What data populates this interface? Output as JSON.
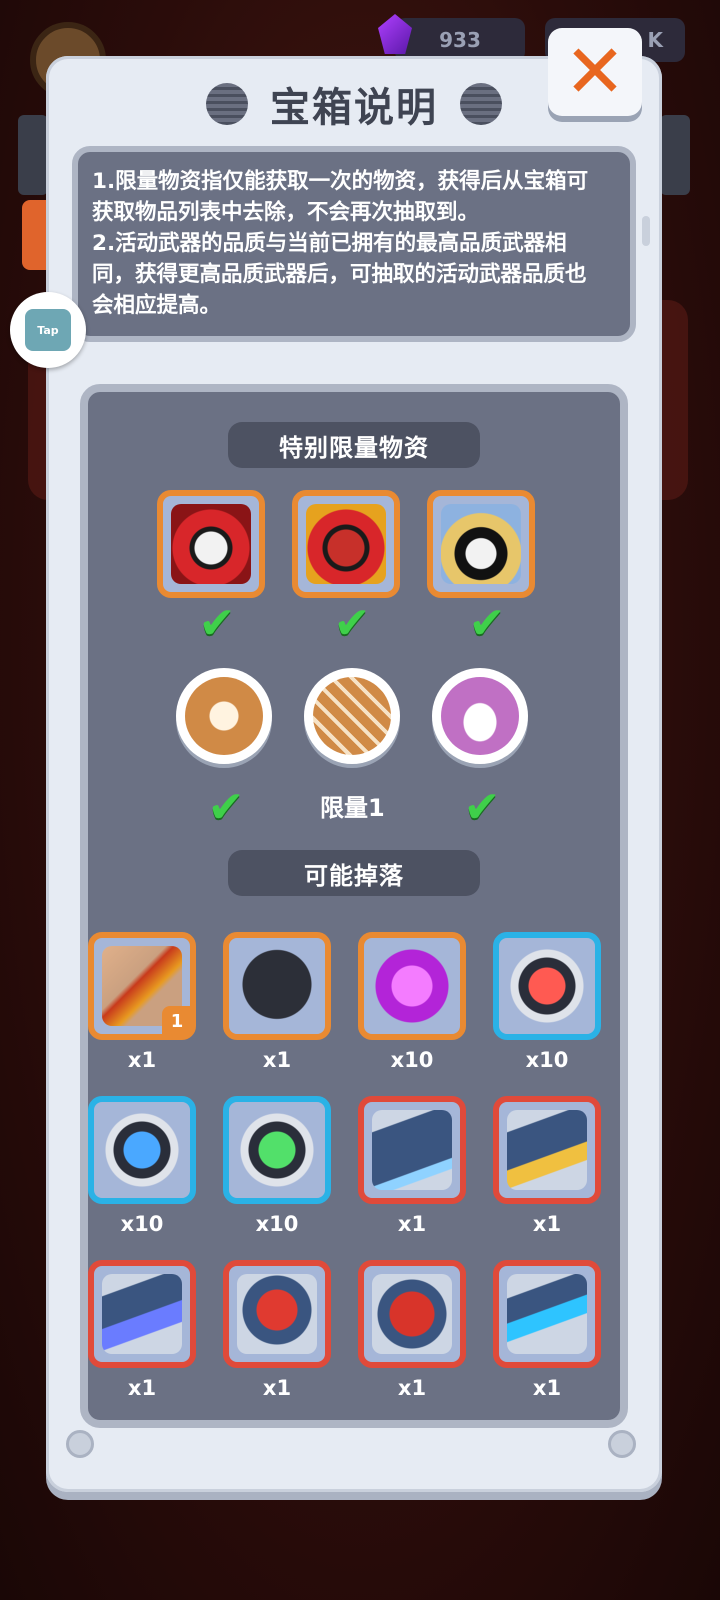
{
  "topbar": {
    "gems": "933",
    "cash": "K"
  },
  "dialog": {
    "title": "宝箱说明",
    "description_lines": [
      "1.限量物资指仅能获取一次的物资，获得后从宝箱可",
      "获取物品列表中去除，不会再次抽取到。",
      "2.活动武器的品质与当前已拥有的最高品质武器相",
      "同，获得更高品质武器后，可抽取的活动武器品质也",
      "会相应提高。"
    ],
    "tap_label": "Tap"
  },
  "limited": {
    "title": "特别限量物资",
    "skins": [
      {
        "icon": "red-hood-skull-icon",
        "obtained": true
      },
      {
        "icon": "monkey-king-skull-icon",
        "obtained": true
      },
      {
        "icon": "straw-hat-skull-icon",
        "obtained": true
      }
    ],
    "tokens": [
      {
        "icon": "lion-statue-icon",
        "obtained": true,
        "label": ""
      },
      {
        "icon": "firecracker-icon",
        "obtained": false,
        "label": "限量1"
      },
      {
        "icon": "gold-ingot-icon",
        "obtained": true,
        "label": ""
      }
    ],
    "check_mark": "✔"
  },
  "drops": {
    "title": "可能掉落",
    "items": [
      {
        "icon": "dragon-gun-icon",
        "rarity": "orange",
        "qty": "x1",
        "badge": "1"
      },
      {
        "icon": "mystery-character-icon",
        "rarity": "orange",
        "qty": "x1"
      },
      {
        "icon": "purple-gem-icon",
        "rarity": "orange",
        "qty": "x10"
      },
      {
        "icon": "red-fist-token-icon",
        "rarity": "blue",
        "qty": "x10"
      },
      {
        "icon": "blue-fist-token-icon",
        "rarity": "blue",
        "qty": "x10"
      },
      {
        "icon": "green-fist-token-icon",
        "rarity": "blue",
        "qty": "x10"
      },
      {
        "icon": "blue-gun-crate-icon",
        "rarity": "red",
        "qty": "x1"
      },
      {
        "icon": "yellow-gun-crate-icon",
        "rarity": "red",
        "qty": "x1"
      },
      {
        "icon": "rocket-crate-icon",
        "rarity": "red",
        "qty": "x1"
      },
      {
        "icon": "helmet-crate-icon",
        "rarity": "red",
        "qty": "x1"
      },
      {
        "icon": "armor-crate-icon",
        "rarity": "red",
        "qty": "x1"
      },
      {
        "icon": "goggles-crate-icon",
        "rarity": "red",
        "qty": "x1"
      }
    ]
  },
  "colors": {
    "accent": "#e8661f",
    "panel": "#e6ebf3",
    "inner": "#6b7184",
    "check": "#3fd04a"
  }
}
